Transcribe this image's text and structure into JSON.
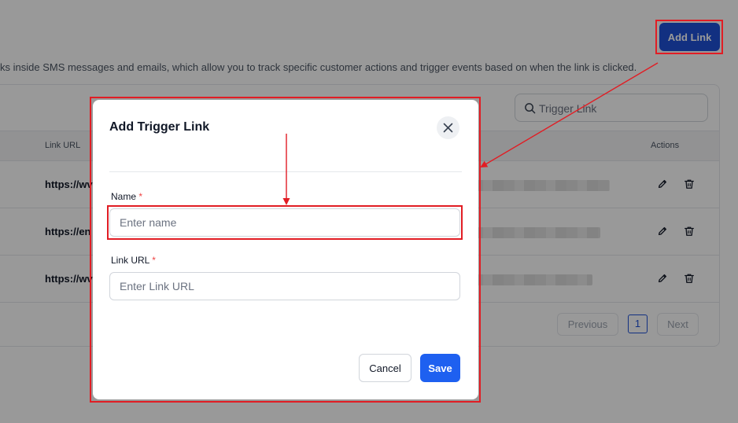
{
  "header": {
    "add_link_label": "Add Link",
    "description": "ks inside SMS messages and emails, which allow you to track specific customer actions and trigger events based on when the link is clicked."
  },
  "search": {
    "placeholder": "Trigger Link",
    "icon": "search-icon"
  },
  "table": {
    "columns": {
      "link_url": "Link URL",
      "actions": "Actions"
    },
    "rows": [
      {
        "url": "https://wv"
      },
      {
        "url": "https://en"
      },
      {
        "url": "https://wv"
      }
    ]
  },
  "pagination": {
    "previous": "Previous",
    "current": "1",
    "next": "Next"
  },
  "modal": {
    "title": "Add Trigger Link",
    "name_label": "Name",
    "name_placeholder": "Enter name",
    "url_label": "Link URL",
    "url_placeholder": "Enter Link URL",
    "required_mark": "*",
    "cancel_label": "Cancel",
    "save_label": "Save"
  },
  "colors": {
    "primary": "#1e50d8",
    "save": "#1e60f0",
    "annotation": "#e11d24",
    "overlay": "rgba(0,0,0,0.40)"
  }
}
